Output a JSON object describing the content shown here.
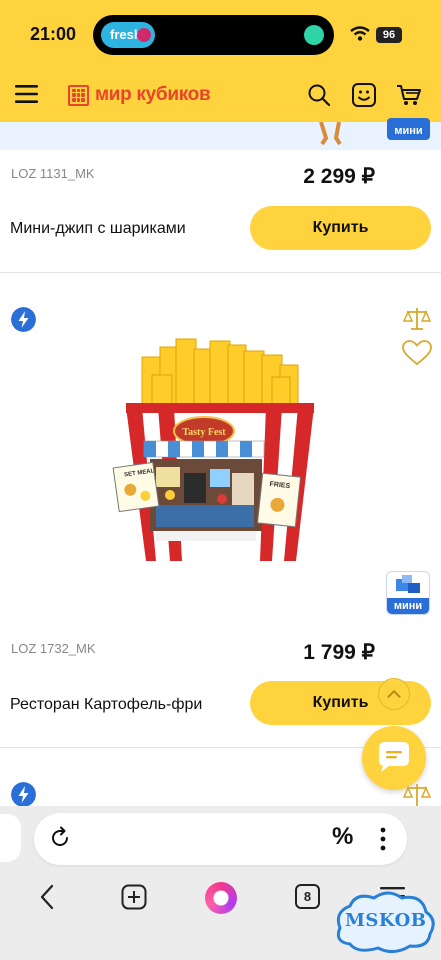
{
  "status_bar": {
    "time": "21:00",
    "island_pill": "fresh",
    "battery": "96"
  },
  "header": {
    "logo_text": "мир кубиков",
    "icons": [
      "menu-icon",
      "search-icon",
      "smiley-icon",
      "cart-icon"
    ],
    "accent_color": "#ffd33d",
    "brand_color": "#e8452c"
  },
  "products": [
    {
      "sku": "LOZ 1131_MK",
      "price": "2 299 ₽",
      "title": "Мини-джип с шариками",
      "buy_label": "Купить",
      "badge": "мини"
    },
    {
      "sku": "LOZ 1732_MK",
      "price": "1 799 ₽",
      "title": "Ресторан Картофель-фри",
      "buy_label": "Купить",
      "badge": "мини",
      "image_text": [
        "Tasty Fest",
        "SET MEAL",
        "FRIES"
      ]
    }
  ],
  "browser": {
    "omnibox_icons": [
      "reload-icon",
      "percent-icon",
      "kebab-icon"
    ],
    "tab_count": "8"
  },
  "watermark": "MSKOB"
}
